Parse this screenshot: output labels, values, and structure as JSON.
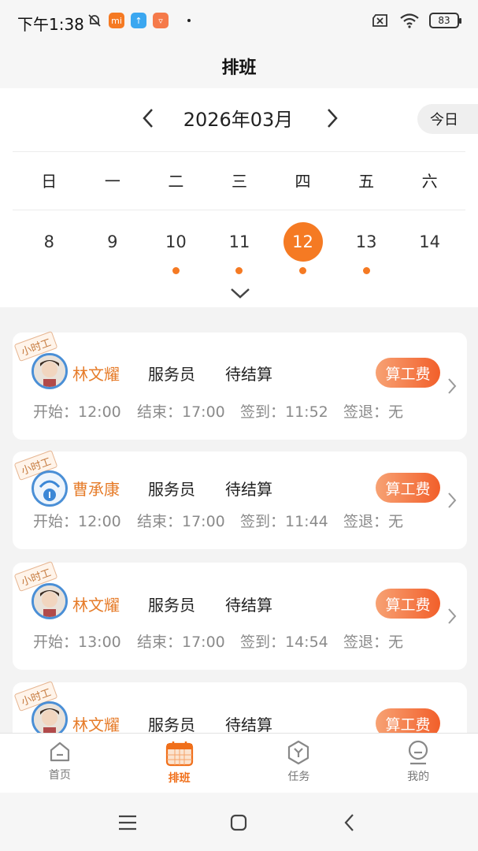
{
  "status_bar": {
    "time": "下午1:38",
    "mi_badge": "mi",
    "battery": "83",
    "colors": {
      "mi": "#f57a23",
      "app2": "#3ba7f0",
      "app3": "#f57a4a"
    }
  },
  "header": {
    "title": "排班"
  },
  "calendar": {
    "month": "2026年03月",
    "today_label": "今日",
    "weekdays": [
      "日",
      "一",
      "二",
      "三",
      "四",
      "五",
      "六"
    ],
    "dates": [
      {
        "day": "8",
        "dot": false,
        "selected": false
      },
      {
        "day": "9",
        "dot": false,
        "selected": false
      },
      {
        "day": "10",
        "dot": true,
        "selected": false
      },
      {
        "day": "11",
        "dot": true,
        "selected": false
      },
      {
        "day": "12",
        "dot": true,
        "selected": true
      },
      {
        "day": "13",
        "dot": true,
        "selected": false
      },
      {
        "day": "14",
        "dot": false,
        "selected": false
      }
    ],
    "accent": "#f57a23"
  },
  "shifts": [
    {
      "tag": "小时工",
      "name": "林文耀",
      "role": "服务员",
      "status": "待结算",
      "action": "算工费",
      "start": "开始：12:00",
      "end": "结束：17:00",
      "checkin": "签到：11:52",
      "checkout": "签退：无",
      "avatar": "photo-avatar"
    },
    {
      "tag": "小时工",
      "name": "曹承康",
      "role": "服务员",
      "status": "待结算",
      "action": "算工费",
      "start": "开始：12:00",
      "end": "结束：17:00",
      "checkin": "签到：11:44",
      "checkout": "签退：无",
      "avatar": "default-avatar"
    },
    {
      "tag": "小时工",
      "name": "林文耀",
      "role": "服务员",
      "status": "待结算",
      "action": "算工费",
      "start": "开始：13:00",
      "end": "结束：17:00",
      "checkin": "签到：14:54",
      "checkout": "签退：无",
      "avatar": "photo-avatar"
    },
    {
      "tag": "小时工",
      "name": "林文耀",
      "role": "服务员",
      "status": "待结算",
      "action": "算工费",
      "start": "",
      "end": "",
      "checkin": "",
      "checkout": "",
      "avatar": "photo-avatar"
    }
  ],
  "tabs": [
    {
      "label": "首页",
      "icon": "home-icon",
      "active": false
    },
    {
      "label": "排班",
      "icon": "calendar-icon",
      "active": true
    },
    {
      "label": "任务",
      "icon": "task-icon",
      "active": false
    },
    {
      "label": "我的",
      "icon": "profile-icon",
      "active": false
    }
  ]
}
